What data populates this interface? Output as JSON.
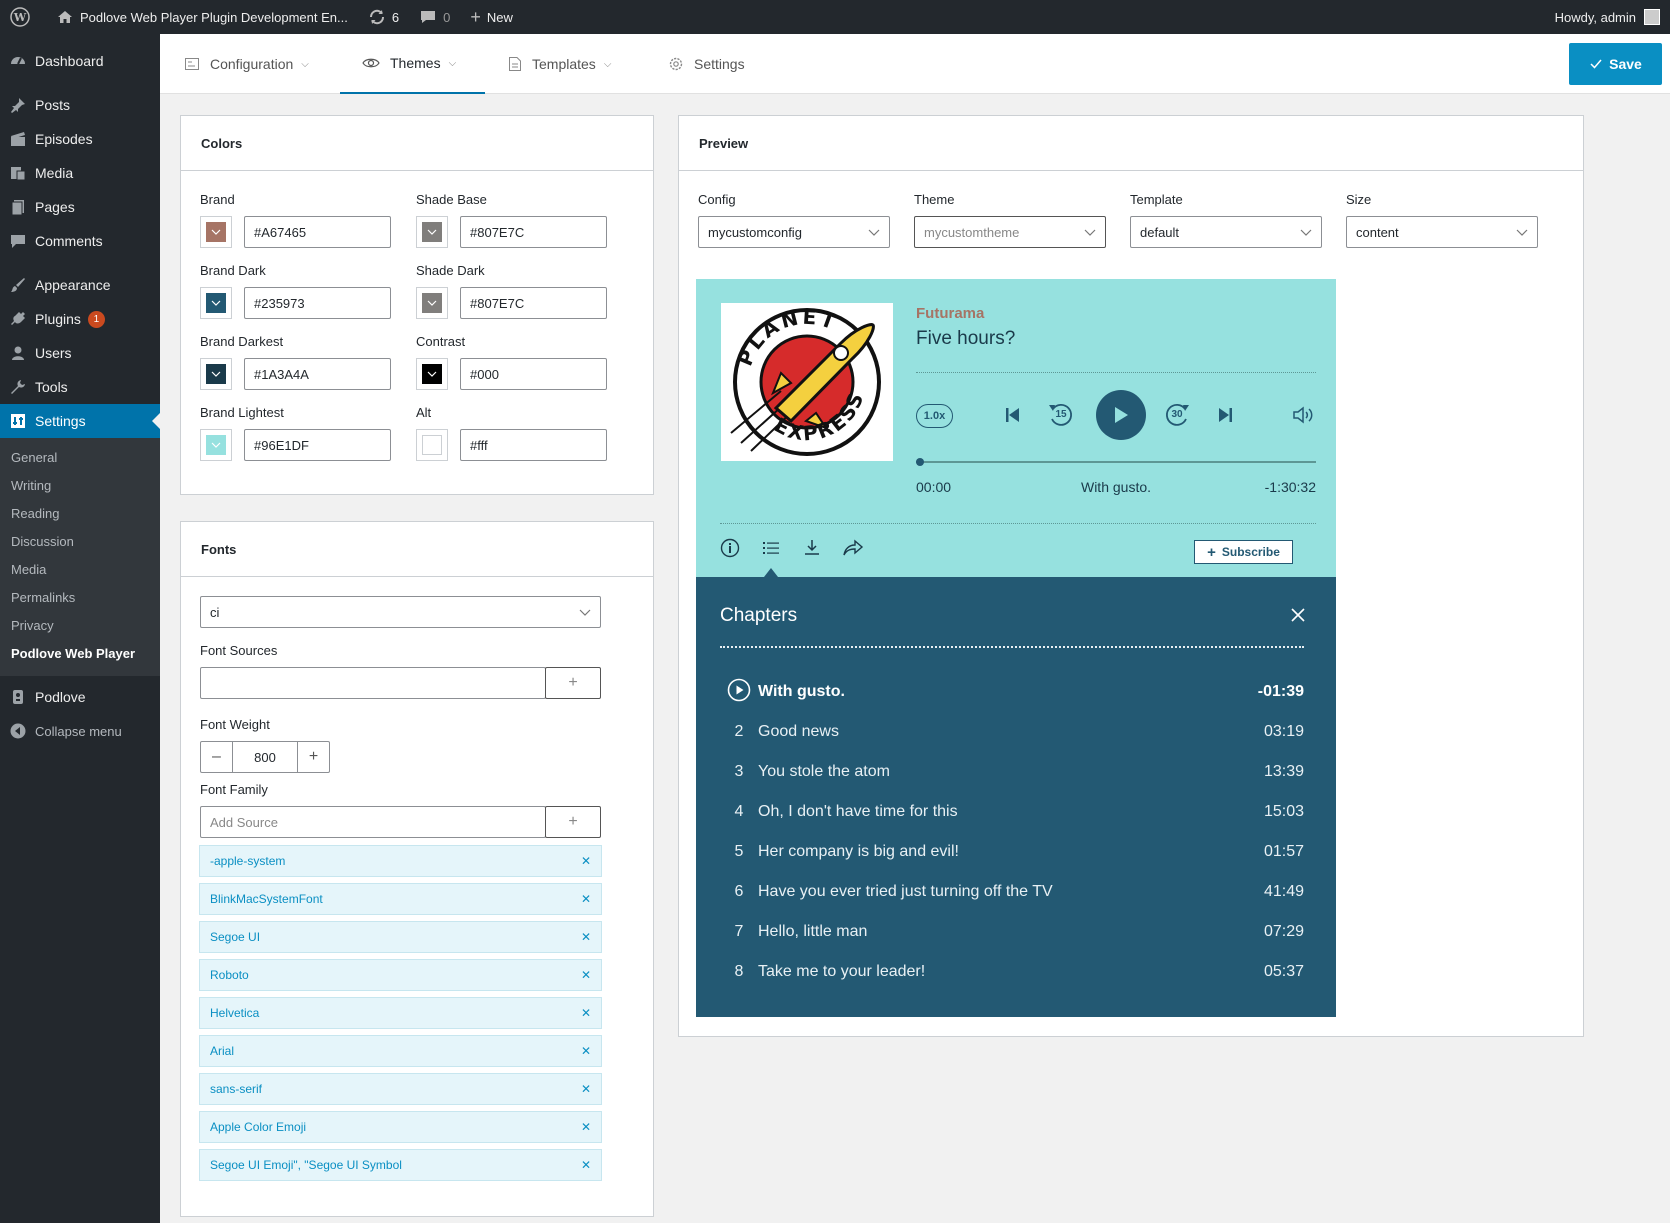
{
  "adminbar": {
    "site_name": "Podlove Web Player Plugin Development En...",
    "updates": "6",
    "comments": "0",
    "new_label": "New",
    "howdy": "Howdy, admin"
  },
  "sidebar": {
    "items": [
      {
        "label": "Dashboard",
        "icon": "dashboard-icon"
      },
      {
        "label": "Posts",
        "icon": "pin-icon"
      },
      {
        "label": "Episodes",
        "icon": "clapper-icon"
      },
      {
        "label": "Media",
        "icon": "media-icon"
      },
      {
        "label": "Pages",
        "icon": "pages-icon"
      },
      {
        "label": "Comments",
        "icon": "comment-icon"
      },
      {
        "label": "Appearance",
        "icon": "brush-icon"
      },
      {
        "label": "Plugins",
        "icon": "plug-icon",
        "badge": "1"
      },
      {
        "label": "Users",
        "icon": "users-icon"
      },
      {
        "label": "Tools",
        "icon": "wrench-icon"
      },
      {
        "label": "Settings",
        "icon": "settings-icon"
      }
    ],
    "submenu": [
      "General",
      "Writing",
      "Reading",
      "Discussion",
      "Media",
      "Permalinks",
      "Privacy",
      "Podlove Web Player"
    ],
    "podlove": "Podlove",
    "collapse": "Collapse menu"
  },
  "tabs": {
    "configuration": "Configuration",
    "themes": "Themes",
    "templates": "Templates",
    "settings": "Settings",
    "save": "Save"
  },
  "colors": {
    "title": "Colors",
    "fields": [
      {
        "label": "Brand",
        "value": "#A67465"
      },
      {
        "label": "Shade Base",
        "value": "#807E7C"
      },
      {
        "label": "Brand Dark",
        "value": "#235973"
      },
      {
        "label": "Shade Dark",
        "value": "#807E7C"
      },
      {
        "label": "Brand Darkest",
        "value": "#1A3A4A"
      },
      {
        "label": "Contrast",
        "value": "#000"
      },
      {
        "label": "Brand Lightest",
        "value": "#96E1DF"
      },
      {
        "label": "Alt",
        "value": "#fff"
      }
    ]
  },
  "fonts": {
    "title": "Fonts",
    "selected": "ci",
    "sources_label": "Font Sources",
    "sources_value": "",
    "weight_label": "Font Weight",
    "weight_value": "800",
    "family_label": "Font Family",
    "family_placeholder": "Add Source",
    "families": [
      "-apple-system",
      "BlinkMacSystemFont",
      "Segoe UI",
      "Roboto",
      "Helvetica",
      "Arial",
      "sans-serif",
      "Apple Color Emoji",
      "Segoe UI Emoji\", \"Segoe UI Symbol"
    ]
  },
  "preview": {
    "title": "Preview",
    "config_label": "Config",
    "config_value": "mycustomconfig",
    "theme_label": "Theme",
    "theme_value": "mycustomtheme",
    "template_label": "Template",
    "template_value": "default",
    "size_label": "Size",
    "size_value": "content"
  },
  "player": {
    "show": "Futurama",
    "episode": "Five hours?",
    "speed": "1.0x",
    "rewind": "15",
    "forward": "30",
    "time_current": "00:00",
    "current_chapter": "With gusto.",
    "time_remaining": "-1:30:32",
    "subscribe": "Subscribe",
    "cover_text_top": "PLANET",
    "cover_text_bottom": "EXPRESS"
  },
  "chapters": {
    "title": "Chapters",
    "items": [
      {
        "num": "",
        "title": "With gusto.",
        "time": "-01:39",
        "active": true
      },
      {
        "num": "2",
        "title": "Good news",
        "time": "03:19"
      },
      {
        "num": "3",
        "title": "You stole the atom",
        "time": "13:39"
      },
      {
        "num": "4",
        "title": "Oh, I don't have time for this",
        "time": "15:03"
      },
      {
        "num": "5",
        "title": "Her company is big and evil!",
        "time": "01:57"
      },
      {
        "num": "6",
        "title": "Have you ever tried just turning off the TV",
        "time": "41:49"
      },
      {
        "num": "7",
        "title": "Hello, little man",
        "time": "07:29"
      },
      {
        "num": "8",
        "title": "Take me to your leader!",
        "time": "05:37"
      }
    ]
  }
}
